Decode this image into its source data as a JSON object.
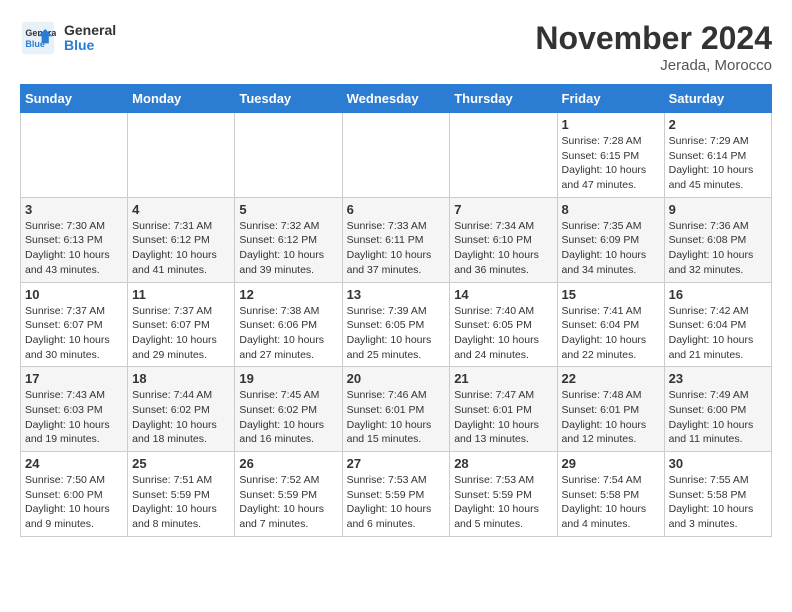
{
  "header": {
    "logo_line1": "General",
    "logo_line2": "Blue",
    "month_title": "November 2024",
    "location": "Jerada, Morocco"
  },
  "weekdays": [
    "Sunday",
    "Monday",
    "Tuesday",
    "Wednesday",
    "Thursday",
    "Friday",
    "Saturday"
  ],
  "weeks": [
    {
      "days": [
        {
          "number": "",
          "info": ""
        },
        {
          "number": "",
          "info": ""
        },
        {
          "number": "",
          "info": ""
        },
        {
          "number": "",
          "info": ""
        },
        {
          "number": "",
          "info": ""
        },
        {
          "number": "1",
          "info": "Sunrise: 7:28 AM\nSunset: 6:15 PM\nDaylight: 10 hours\nand 47 minutes."
        },
        {
          "number": "2",
          "info": "Sunrise: 7:29 AM\nSunset: 6:14 PM\nDaylight: 10 hours\nand 45 minutes."
        }
      ]
    },
    {
      "days": [
        {
          "number": "3",
          "info": "Sunrise: 7:30 AM\nSunset: 6:13 PM\nDaylight: 10 hours\nand 43 minutes."
        },
        {
          "number": "4",
          "info": "Sunrise: 7:31 AM\nSunset: 6:12 PM\nDaylight: 10 hours\nand 41 minutes."
        },
        {
          "number": "5",
          "info": "Sunrise: 7:32 AM\nSunset: 6:12 PM\nDaylight: 10 hours\nand 39 minutes."
        },
        {
          "number": "6",
          "info": "Sunrise: 7:33 AM\nSunset: 6:11 PM\nDaylight: 10 hours\nand 37 minutes."
        },
        {
          "number": "7",
          "info": "Sunrise: 7:34 AM\nSunset: 6:10 PM\nDaylight: 10 hours\nand 36 minutes."
        },
        {
          "number": "8",
          "info": "Sunrise: 7:35 AM\nSunset: 6:09 PM\nDaylight: 10 hours\nand 34 minutes."
        },
        {
          "number": "9",
          "info": "Sunrise: 7:36 AM\nSunset: 6:08 PM\nDaylight: 10 hours\nand 32 minutes."
        }
      ]
    },
    {
      "days": [
        {
          "number": "10",
          "info": "Sunrise: 7:37 AM\nSunset: 6:07 PM\nDaylight: 10 hours\nand 30 minutes."
        },
        {
          "number": "11",
          "info": "Sunrise: 7:37 AM\nSunset: 6:07 PM\nDaylight: 10 hours\nand 29 minutes."
        },
        {
          "number": "12",
          "info": "Sunrise: 7:38 AM\nSunset: 6:06 PM\nDaylight: 10 hours\nand 27 minutes."
        },
        {
          "number": "13",
          "info": "Sunrise: 7:39 AM\nSunset: 6:05 PM\nDaylight: 10 hours\nand 25 minutes."
        },
        {
          "number": "14",
          "info": "Sunrise: 7:40 AM\nSunset: 6:05 PM\nDaylight: 10 hours\nand 24 minutes."
        },
        {
          "number": "15",
          "info": "Sunrise: 7:41 AM\nSunset: 6:04 PM\nDaylight: 10 hours\nand 22 minutes."
        },
        {
          "number": "16",
          "info": "Sunrise: 7:42 AM\nSunset: 6:04 PM\nDaylight: 10 hours\nand 21 minutes."
        }
      ]
    },
    {
      "days": [
        {
          "number": "17",
          "info": "Sunrise: 7:43 AM\nSunset: 6:03 PM\nDaylight: 10 hours\nand 19 minutes."
        },
        {
          "number": "18",
          "info": "Sunrise: 7:44 AM\nSunset: 6:02 PM\nDaylight: 10 hours\nand 18 minutes."
        },
        {
          "number": "19",
          "info": "Sunrise: 7:45 AM\nSunset: 6:02 PM\nDaylight: 10 hours\nand 16 minutes."
        },
        {
          "number": "20",
          "info": "Sunrise: 7:46 AM\nSunset: 6:01 PM\nDaylight: 10 hours\nand 15 minutes."
        },
        {
          "number": "21",
          "info": "Sunrise: 7:47 AM\nSunset: 6:01 PM\nDaylight: 10 hours\nand 13 minutes."
        },
        {
          "number": "22",
          "info": "Sunrise: 7:48 AM\nSunset: 6:01 PM\nDaylight: 10 hours\nand 12 minutes."
        },
        {
          "number": "23",
          "info": "Sunrise: 7:49 AM\nSunset: 6:00 PM\nDaylight: 10 hours\nand 11 minutes."
        }
      ]
    },
    {
      "days": [
        {
          "number": "24",
          "info": "Sunrise: 7:50 AM\nSunset: 6:00 PM\nDaylight: 10 hours\nand 9 minutes."
        },
        {
          "number": "25",
          "info": "Sunrise: 7:51 AM\nSunset: 5:59 PM\nDaylight: 10 hours\nand 8 minutes."
        },
        {
          "number": "26",
          "info": "Sunrise: 7:52 AM\nSunset: 5:59 PM\nDaylight: 10 hours\nand 7 minutes."
        },
        {
          "number": "27",
          "info": "Sunrise: 7:53 AM\nSunset: 5:59 PM\nDaylight: 10 hours\nand 6 minutes."
        },
        {
          "number": "28",
          "info": "Sunrise: 7:53 AM\nSunset: 5:59 PM\nDaylight: 10 hours\nand 5 minutes."
        },
        {
          "number": "29",
          "info": "Sunrise: 7:54 AM\nSunset: 5:58 PM\nDaylight: 10 hours\nand 4 minutes."
        },
        {
          "number": "30",
          "info": "Sunrise: 7:55 AM\nSunset: 5:58 PM\nDaylight: 10 hours\nand 3 minutes."
        }
      ]
    }
  ]
}
